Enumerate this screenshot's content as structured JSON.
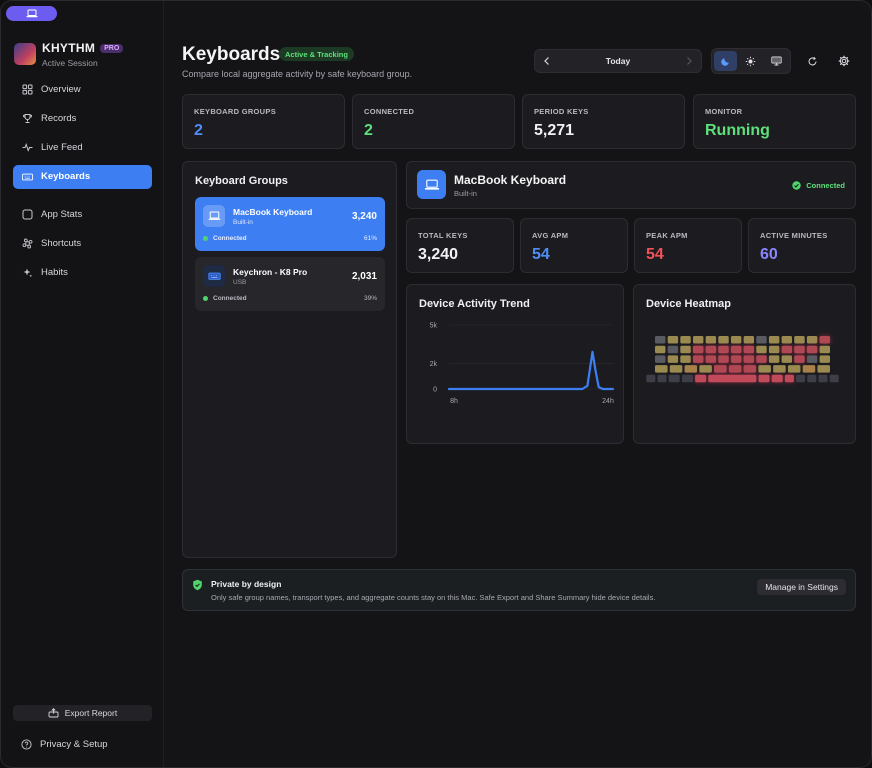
{
  "sidebar": {
    "brand": {
      "name": "KHYTHM",
      "badge": "PRO",
      "subtitle": "Active Session"
    },
    "nav": [
      {
        "label": "Overview",
        "icon": "grid-icon"
      },
      {
        "label": "Records",
        "icon": "trophy-icon"
      },
      {
        "label": "Live Feed",
        "icon": "pulse-icon"
      },
      {
        "label": "Keyboards",
        "icon": "keyboard-icon",
        "active": true
      },
      {
        "label": "App Stats",
        "icon": "square-icon"
      },
      {
        "label": "Shortcuts",
        "icon": "command-icon"
      },
      {
        "label": "Habits",
        "icon": "sparkle-icon"
      }
    ],
    "export_label": "Export Report",
    "privacy_label": "Privacy & Setup"
  },
  "header": {
    "title": "Keyboards",
    "status": "Active & Tracking",
    "subtitle": "Compare local aggregate activity by safe keyboard group.",
    "date_label": "Today"
  },
  "stats": [
    {
      "label": "KEYBOARD GROUPS",
      "value": "2",
      "color": "#4f8ef7"
    },
    {
      "label": "CONNECTED",
      "value": "2",
      "color": "#5ee07a"
    },
    {
      "label": "PERIOD KEYS",
      "value": "5,271",
      "color": "#f2f2f5"
    },
    {
      "label": "MONITOR",
      "value": "Running",
      "color": "#5ee07a"
    }
  ],
  "groups": {
    "title": "Keyboard Groups",
    "items": [
      {
        "name": "MacBook Keyboard",
        "transport": "Built-in",
        "count": "3,240",
        "status": "Connected",
        "share": "61%",
        "selected": true
      },
      {
        "name": "Keychron - K8 Pro",
        "transport": "USB",
        "count": "2,031",
        "status": "Connected",
        "share": "39%",
        "selected": false
      }
    ]
  },
  "device": {
    "name": "MacBook Keyboard",
    "transport": "Built-in",
    "status": "Connected",
    "metrics": [
      {
        "label": "TOTAL KEYS",
        "value": "3,240",
        "color": "#f2f2f5"
      },
      {
        "label": "AVG APM",
        "value": "54",
        "color": "#4f8ef7"
      },
      {
        "label": "PEAK APM",
        "value": "54",
        "color": "#f0525a"
      },
      {
        "label": "ACTIVE MINUTES",
        "value": "60",
        "color": "#8a86ff"
      }
    ]
  },
  "trend": {
    "title": "Device Activity Trend",
    "line_color": "#3d7ff2"
  },
  "heatmap": {
    "title": "Device Heatmap"
  },
  "privacy": {
    "title": "Private by design",
    "text": "Only safe group names, transport types, and aggregate counts stay on this Mac. Safe Export and Share Summary hide device details.",
    "button": "Manage in Settings"
  },
  "chart_data": {
    "type": "line",
    "title": "Device Activity Trend",
    "x_tick_labels": [
      "8h",
      "24h"
    ],
    "y_ticks": [
      0,
      2000,
      5000
    ],
    "y_tick_labels": [
      "0",
      "2k",
      "5k"
    ],
    "ylim": [
      0,
      5000
    ],
    "x": [
      8,
      9,
      10,
      11,
      12,
      13,
      14,
      15,
      16,
      17,
      18,
      19,
      20,
      21,
      21.5,
      22,
      22.3,
      22.6,
      23,
      24
    ],
    "series": [
      {
        "values": [
          0,
          0,
          0,
          0,
          0,
          0,
          0,
          0,
          0,
          0,
          0,
          0,
          0,
          0,
          250,
          2900,
          1400,
          150,
          0,
          0
        ]
      }
    ],
    "xlabel": "",
    "ylabel": "",
    "grid": true
  }
}
